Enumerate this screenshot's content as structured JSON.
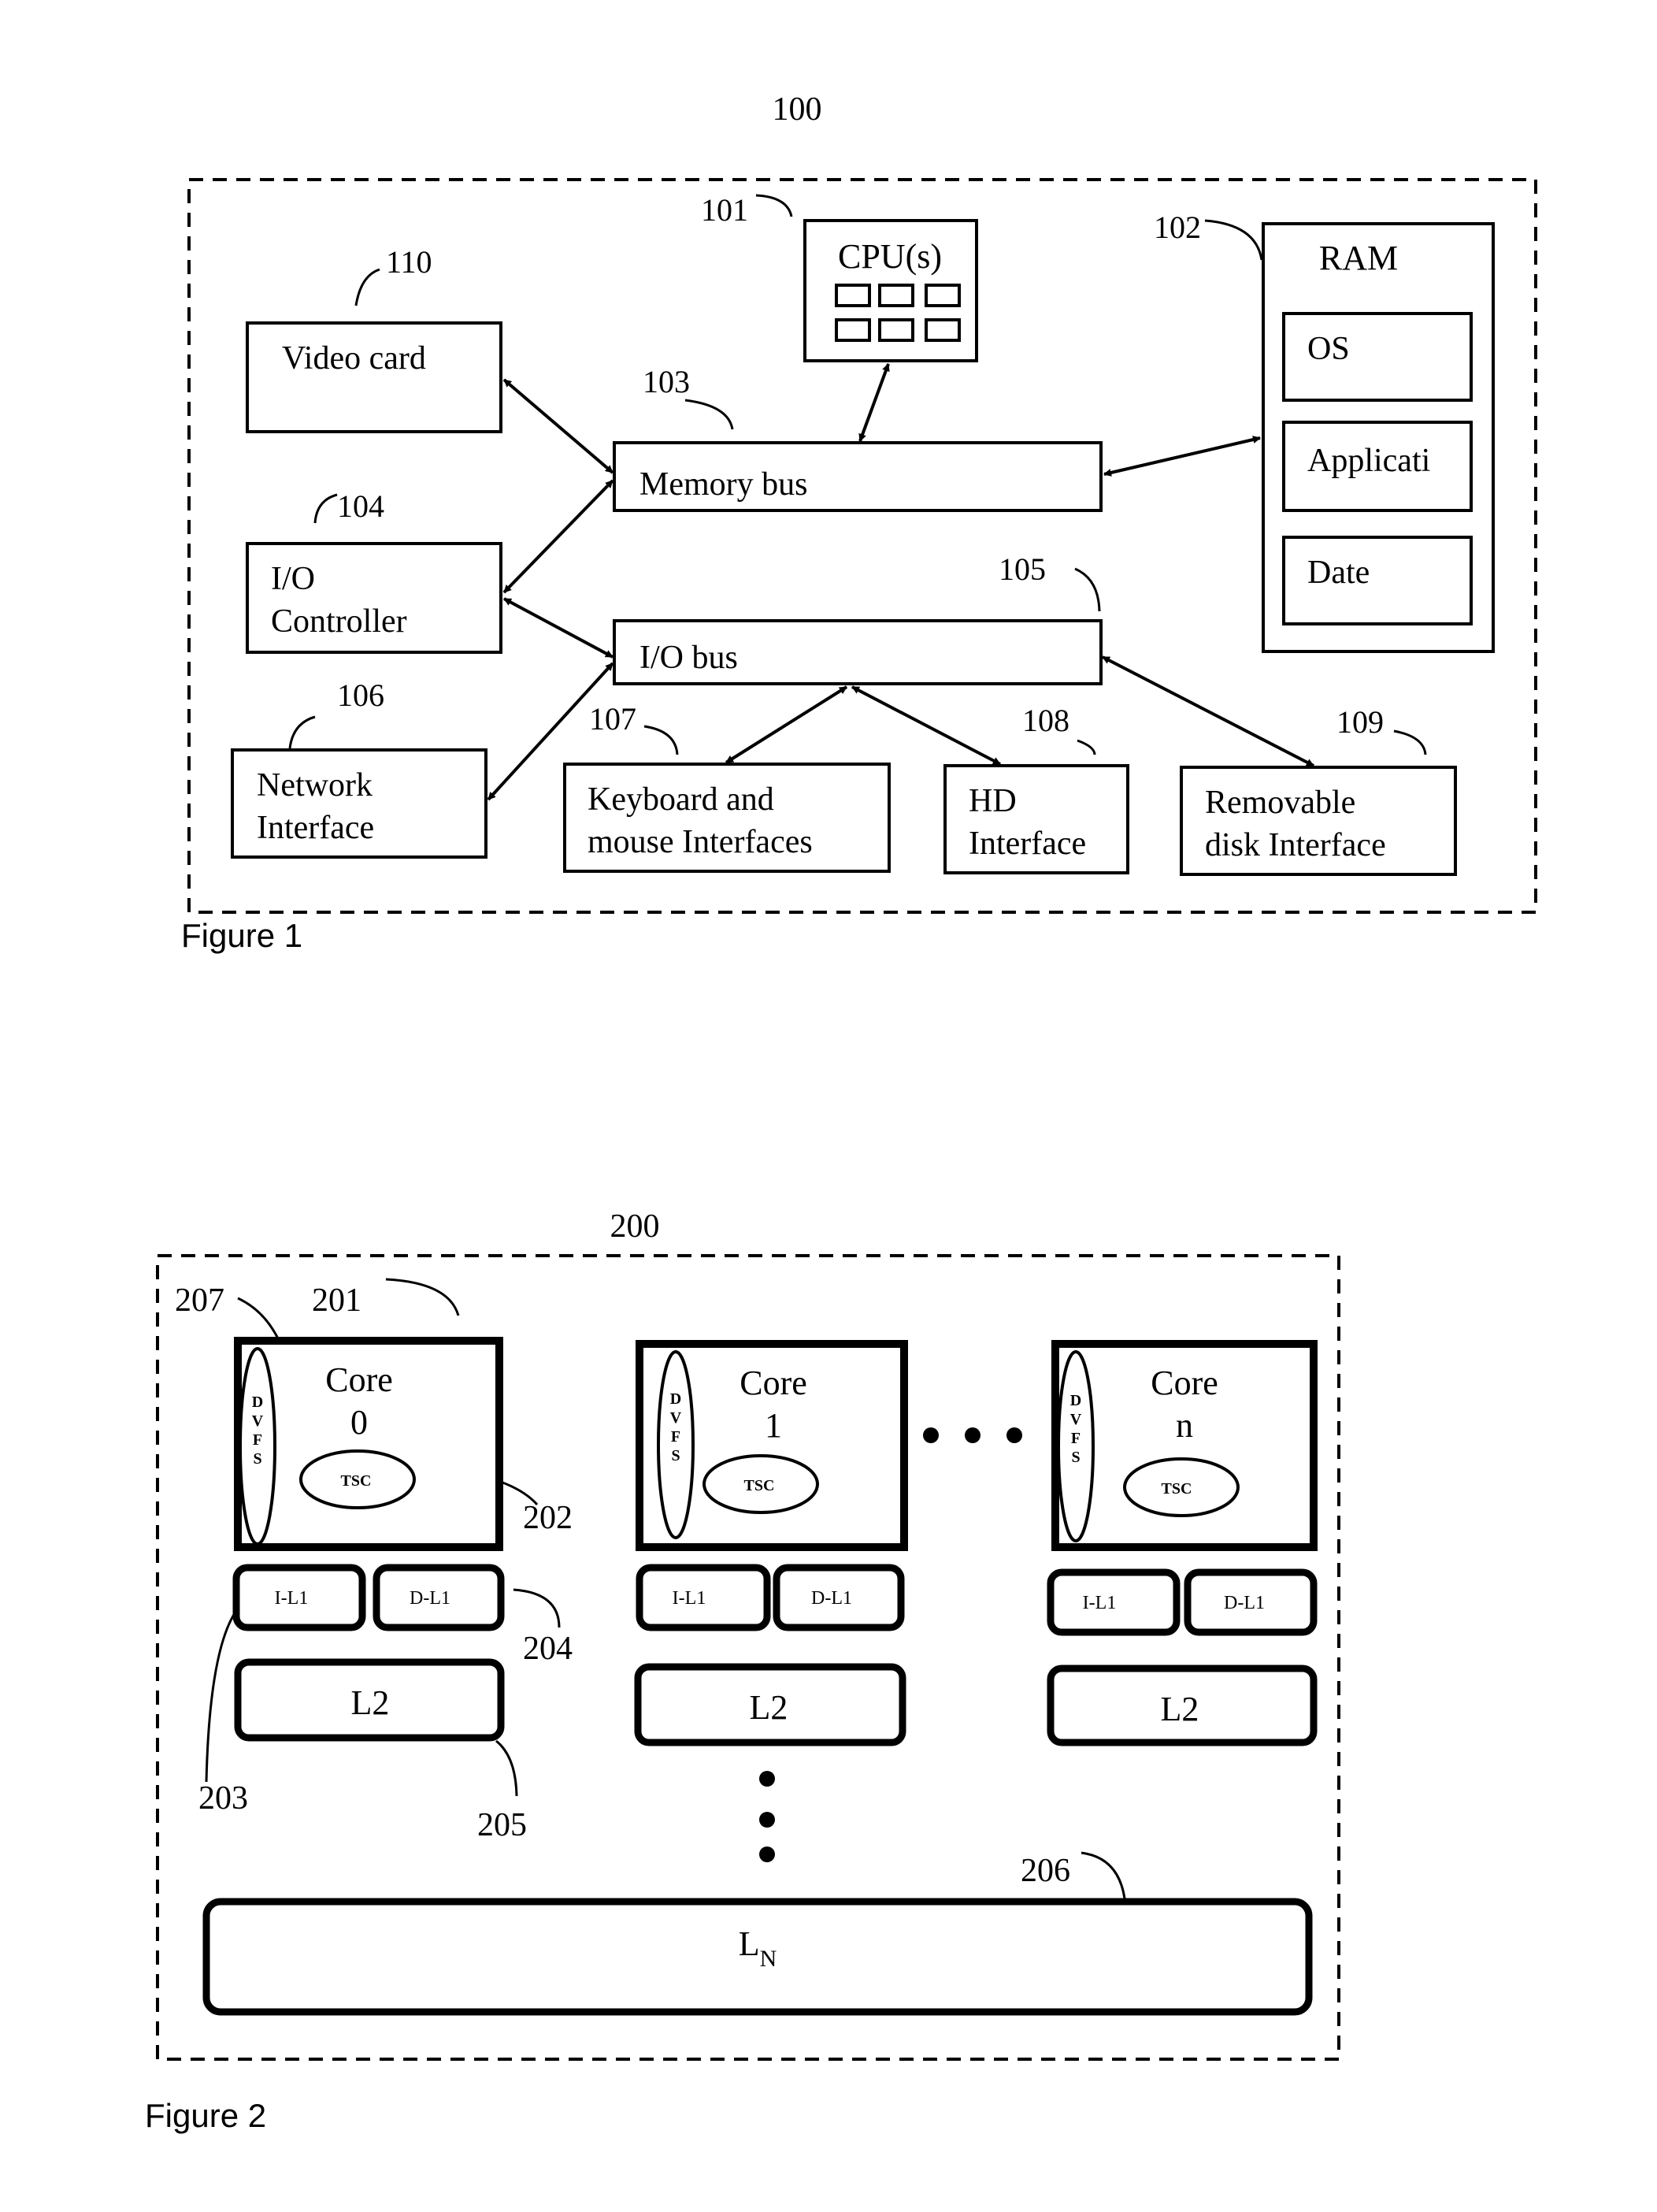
{
  "figure1": {
    "caption": "Figure 1",
    "ref_system": "100",
    "components": {
      "cpu": {
        "ref": "101",
        "label": "CPU(s)"
      },
      "ram": {
        "ref": "102",
        "label": "RAM",
        "sections": [
          "OS",
          "Applicati",
          "Date"
        ]
      },
      "memory_bus": {
        "ref": "103",
        "label": "Memory bus"
      },
      "io_controller": {
        "ref": "104",
        "line1": "I/O",
        "line2": "Controller"
      },
      "io_bus": {
        "ref": "105",
        "label": "I/O bus"
      },
      "network_interface": {
        "ref": "106",
        "line1": "Network",
        "line2": "Interface"
      },
      "keyboard_mouse": {
        "ref": "107",
        "line1": "Keyboard and",
        "line2": "mouse Interfaces"
      },
      "hd_interface": {
        "ref": "108",
        "line1": "HD",
        "line2": "Interface"
      },
      "removable_disk": {
        "ref": "109",
        "line1": "Removable",
        "line2": "disk Interface"
      },
      "video_card": {
        "ref": "110",
        "label": "Video card"
      }
    }
  },
  "figure2": {
    "caption": "Figure 2",
    "ref_system": "200",
    "refs": {
      "core": "201",
      "tsc": "202",
      "il1": "203",
      "dl1": "204",
      "l2": "205",
      "ln": "206",
      "dvfs": "207"
    },
    "cores": [
      {
        "title": "Core",
        "index": "0",
        "dvfs": [
          "D",
          "V",
          "F",
          "S"
        ],
        "tsc": "TSC",
        "il1": "I-L1",
        "dl1": "D-L1",
        "l2": "L2"
      },
      {
        "title": "Core",
        "index": "1",
        "dvfs": [
          "D",
          "V",
          "F",
          "S"
        ],
        "tsc": "TSC",
        "il1": "I-L1",
        "dl1": "D-L1",
        "l2": "L2"
      },
      {
        "title": "Core",
        "index": "n",
        "dvfs": [
          "D",
          "V",
          "F",
          "S"
        ],
        "tsc": "TSC",
        "il1": "I-L1",
        "dl1": "D-L1",
        "l2": "L2"
      }
    ],
    "shared_cache": {
      "base": "L",
      "subscript": "N"
    }
  }
}
